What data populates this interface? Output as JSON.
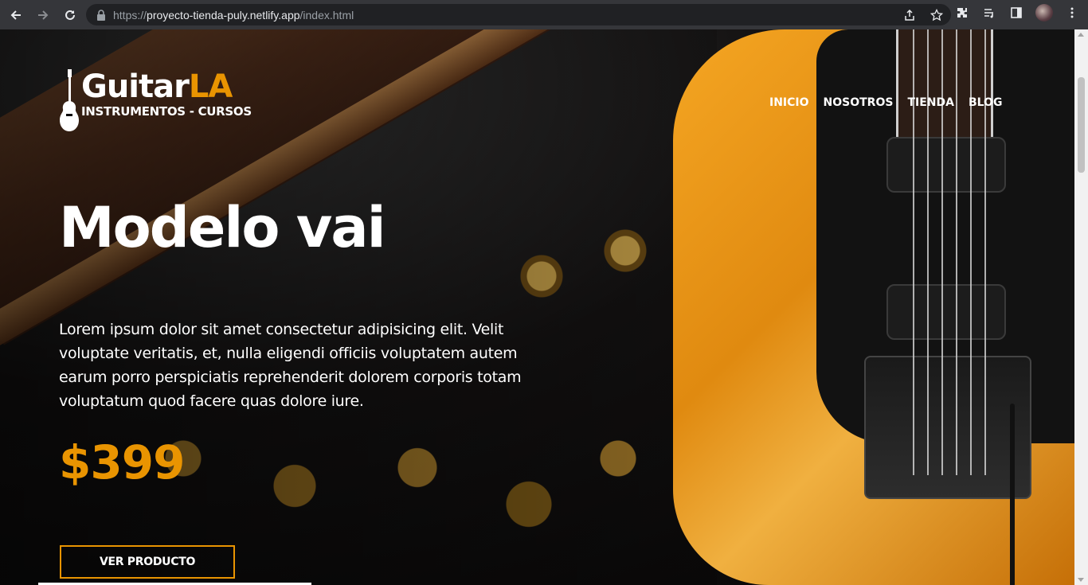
{
  "browser": {
    "url_scheme": "https://",
    "url_host": "proyecto-tienda-puly.netlify.app",
    "url_path": "/index.html",
    "icons": [
      "back-icon",
      "forward-icon",
      "reload-icon",
      "lock-icon",
      "share-icon",
      "bookmark-star-icon",
      "extensions-icon",
      "media-queue-icon",
      "side-panel-icon",
      "profile-avatar",
      "more-menu-icon"
    ]
  },
  "site": {
    "logo": {
      "main": "Guitar",
      "accent": "LA",
      "sub": "INSTRUMENTOS - CURSOS"
    },
    "nav": [
      {
        "label": "INICIO"
      },
      {
        "label": "NOSOTROS"
      },
      {
        "label": "TIENDA"
      },
      {
        "label": "BLOG"
      }
    ],
    "hero": {
      "title": "Modelo vai",
      "description": "Lorem ipsum dolor sit amet consectetur adipisicing elit. Velit voluptate veritatis, et, nulla eligendi officiis voluptatem autem earum porro perspiciatis reprehenderit dolorem corporis totam voluptatum quod facere quas dolore iure.",
      "price": "$399",
      "cta_label": "VER PRODUCTO"
    },
    "colors": {
      "accent": "#e99401",
      "text": "#ffffff"
    }
  }
}
